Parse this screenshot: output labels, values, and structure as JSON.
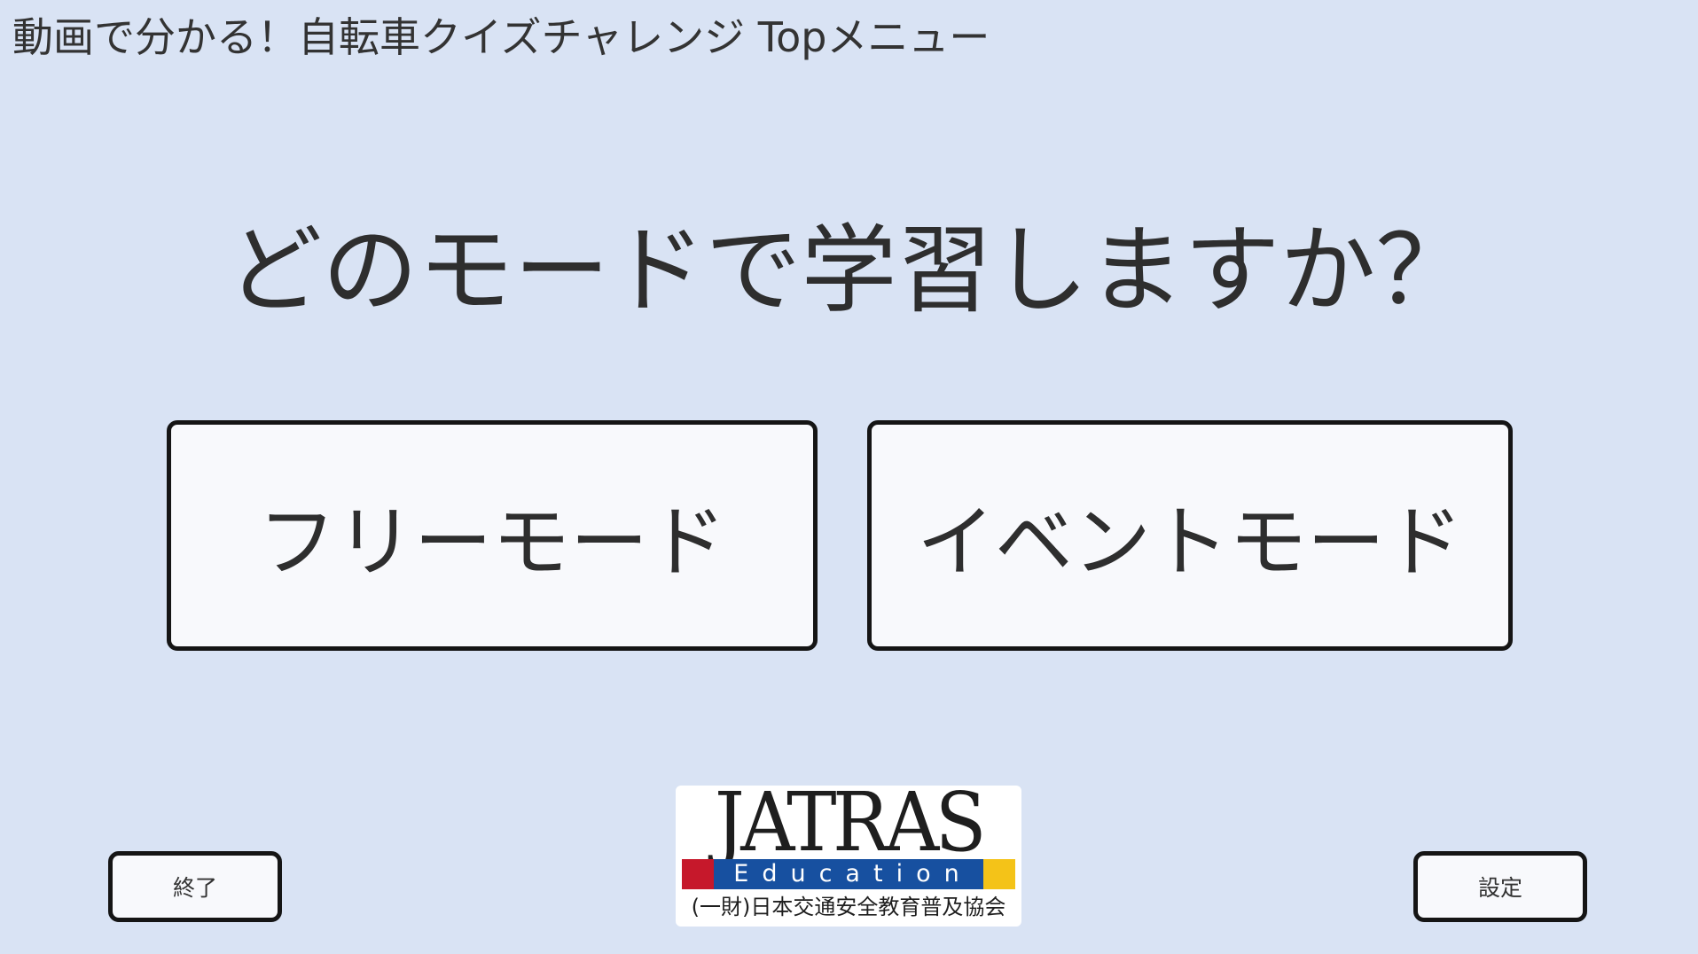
{
  "app": {
    "title": "動画で分かる！自転車クイズチャレンジ Topメニュー"
  },
  "main": {
    "question": "どのモードで学習しますか？",
    "free_mode_label": "フリーモード",
    "event_mode_label": "イベントモード"
  },
  "footer": {
    "exit_label": "終了",
    "settings_label": "設定",
    "logo": {
      "wordmark": "JATRAS",
      "band_text": "Education",
      "org_name": "(一財)日本交通安全教育普及協会"
    }
  },
  "colors": {
    "background": "#d9e3f4",
    "button_fill": "#f8f9fc",
    "button_border": "#151515",
    "logo_red": "#c6182b",
    "logo_blue": "#1750a0",
    "logo_yellow": "#f4c318"
  }
}
